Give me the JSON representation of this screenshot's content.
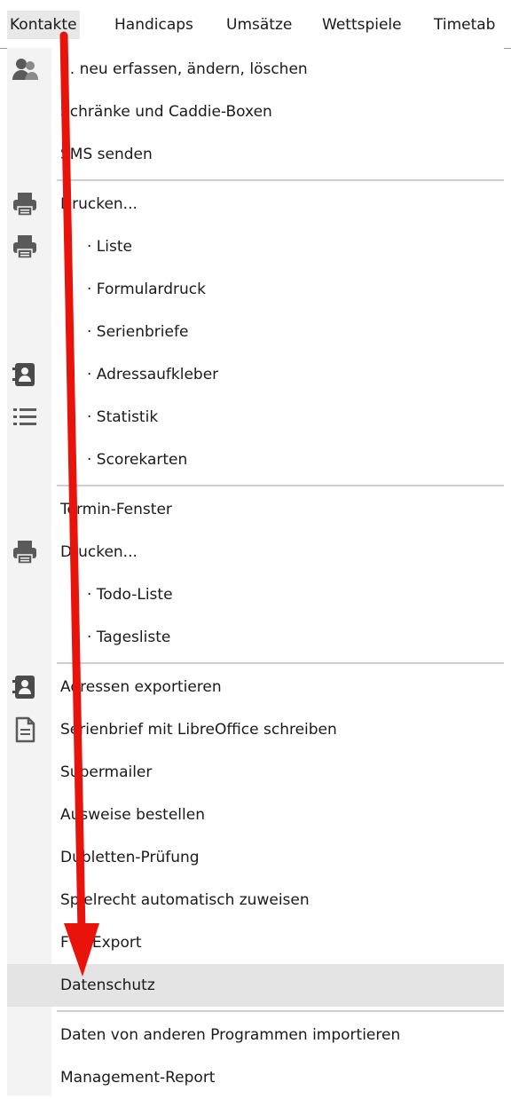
{
  "menubar": {
    "items": [
      {
        "label": "Kontakte",
        "active": true
      },
      {
        "label": "Handicaps"
      },
      {
        "label": "Umsätze"
      },
      {
        "label": "Wettspiele"
      },
      {
        "label": "Timetab"
      }
    ]
  },
  "menu": {
    "items": [
      {
        "label": "... neu erfassen, ändern, löschen",
        "icon": "contacts-icon"
      },
      {
        "label": "Schränke und Caddie-Boxen"
      },
      {
        "label": "SMS senden"
      },
      {
        "label": "Drucken...",
        "icon": "printer-icon"
      },
      {
        "label": "· Liste",
        "icon": "printer-icon"
      },
      {
        "label": "· Formulardruck"
      },
      {
        "label": "· Serienbriefe"
      },
      {
        "label": "· Adressaufkleber",
        "icon": "address-card-icon"
      },
      {
        "label": "· Statistik",
        "icon": "list-icon"
      },
      {
        "label": "· Scorekarten"
      },
      {
        "label": "Termin-Fenster"
      },
      {
        "label": "Drucken...",
        "icon": "printer-icon"
      },
      {
        "label": "· Todo-Liste"
      },
      {
        "label": "· Tagesliste"
      },
      {
        "label": "Adressen exportieren",
        "icon": "address-card-icon"
      },
      {
        "label": "Serienbrief mit LibreOffice schreiben",
        "icon": "document-icon"
      },
      {
        "label": "Supermailer"
      },
      {
        "label": "Ausweise bestellen"
      },
      {
        "label": "Dubletten-Prüfung"
      },
      {
        "label": "Spielrecht automatisch zuweisen"
      },
      {
        "label": "FTP-Export"
      },
      {
        "label": "Datenschutz",
        "highlighted": true
      },
      {
        "label": "Daten von anderen Programmen importieren"
      },
      {
        "label": "Management-Report"
      }
    ]
  },
  "colors": {
    "arrow": "#e8140c",
    "highlight": "#e4e4e4",
    "icon": "#5a5a5a"
  }
}
